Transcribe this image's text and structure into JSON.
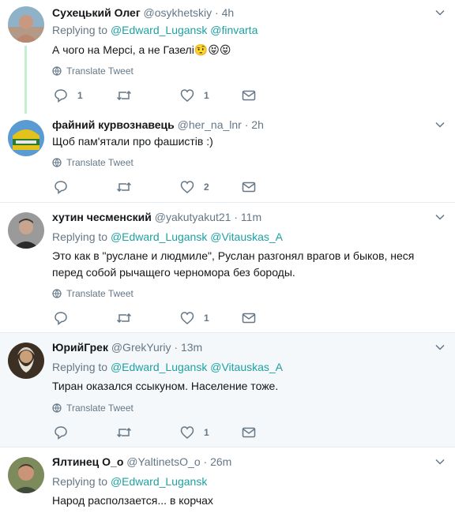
{
  "ui": {
    "translate_label": "Translate Tweet",
    "replying_to": "Replying to",
    "dot": "·",
    "colors": {
      "link": "#17bf63",
      "muted": "#657786",
      "text": "#14171a",
      "thread": "#c4eecf"
    }
  },
  "tweets": [
    {
      "name": "Сухецький Олег",
      "handle": "@osykhetskiy",
      "time": "4h",
      "reply_to": [
        "@Edward_Lugansk",
        "@finvarta"
      ],
      "text": "А чого на Мерсі, а не Газелі🤨😝😝",
      "replies": "1",
      "retweets": "",
      "likes": "1"
    },
    {
      "name": "файний курвознавець",
      "handle": "@her_na_lnr",
      "time": "2h",
      "reply_to": [],
      "text": "Щоб пам'ятали про фашистів :)",
      "replies": "",
      "retweets": "",
      "likes": "2"
    },
    {
      "name": "хутин чесменский",
      "handle": "@yakutyakut21",
      "time": "11m",
      "reply_to": [
        "@Edward_Lugansk",
        "@Vitauskas_A"
      ],
      "text": "Это как в \"руслане и людмиле\", Руслан разгонял врагов и быков, неся перед собой рычащего черномора без бороды.",
      "replies": "",
      "retweets": "",
      "likes": "1"
    },
    {
      "name": "ЮрийГрек",
      "handle": "@GrekYuriy",
      "time": "13m",
      "reply_to": [
        "@Edward_Lugansk",
        "@Vitauskas_A"
      ],
      "text": "Тиран оказался ссыкуном. Население тоже.",
      "replies": "",
      "retweets": "",
      "likes": "1"
    },
    {
      "name": "Ялтинец О_о",
      "handle": "@YaltinetsO_o",
      "time": "26m",
      "reply_to": [
        "@Edward_Lugansk"
      ],
      "text": "Народ расползается... в корчах",
      "replies": "",
      "retweets": "",
      "likes": ""
    }
  ]
}
